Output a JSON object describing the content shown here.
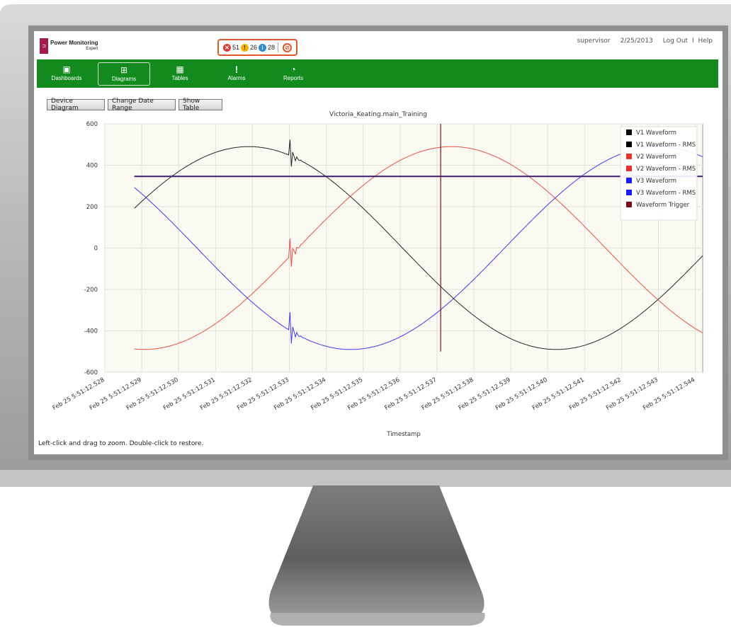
{
  "app": {
    "logo_title": "Power Monitoring",
    "logo_subtitle": "Expert",
    "user": "supervisor",
    "date": "2/25/2013",
    "logout_label": "Log Out",
    "separator": "I",
    "help_label": "Help"
  },
  "alerts": {
    "critical_count": "51",
    "warning_count": "26",
    "info_count": "28"
  },
  "nav": {
    "items": [
      {
        "label": "Dashboards",
        "icon": "dashboard-icon"
      },
      {
        "label": "Diagrams",
        "icon": "diagram-icon"
      },
      {
        "label": "Tables",
        "icon": "table-icon"
      },
      {
        "label": "Alarms",
        "icon": "alarm-icon"
      },
      {
        "label": "Reports",
        "icon": "report-icon"
      }
    ],
    "active": "Diagrams"
  },
  "toolbar": {
    "device_diagram": "Device Diagram",
    "change_date_range": "Change Date Range",
    "show_table": "Show Table"
  },
  "footnote": "Left-click and drag to zoom. Double-click to restore.",
  "colors": {
    "nav_bg": "#138a1e",
    "accent": "#e0582a",
    "v1": "#000000",
    "v2": "#e8332a",
    "v3": "#1a1aff",
    "trigger": "#7a0f1e",
    "rms_line": "#3b1d6e"
  },
  "chart_data": {
    "type": "line",
    "title": "Victoria_Keating.main_Training",
    "xlabel": "Timestamp",
    "ylabel": "",
    "ylim": [
      -600,
      600
    ],
    "yticks": [
      600,
      400,
      200,
      0,
      -200,
      -400,
      -600
    ],
    "xlim": [
      12.528,
      12.5442
    ],
    "xticks": [
      "Feb 25 5:51:12.528",
      "Feb 25 5:51:12.529",
      "Feb 25 5:51:12.530",
      "Feb 25 5:51:12.531",
      "Feb 25 5:51:12.532",
      "Feb 25 5:51:12.533",
      "Feb 25 5:51:12.534",
      "Feb 25 5:51:12.535",
      "Feb 25 5:51:12.536",
      "Feb 25 5:51:12.537",
      "Feb 25 5:51:12.538",
      "Feb 25 5:51:12.539",
      "Feb 25 5:51:12.540",
      "Feb 25 5:51:12.541",
      "Feb 25 5:51:12.542",
      "Feb 25 5:51:12.543",
      "Feb 25 5:51:12.544"
    ],
    "grid": true,
    "legend_position": "top-right",
    "series": [
      {
        "name": "V1 Waveform",
        "x_start": 12.5288,
        "x_end": 12.5442,
        "amplitude": 490,
        "peak_at": 12.5319,
        "period": 0.01667
      },
      {
        "name": "V1 Waveform - RMS",
        "value": 346
      },
      {
        "name": "V2 Waveform",
        "x_start": 12.5288,
        "x_end": 12.5442,
        "amplitude": 490,
        "peak_at": 12.5374,
        "period": 0.01667
      },
      {
        "name": "V2 Waveform - RMS",
        "value": 346
      },
      {
        "name": "V3 Waveform",
        "x_start": 12.5288,
        "x_end": 12.5442,
        "amplitude": 490,
        "peak_at": 12.543,
        "period": 0.01667
      },
      {
        "name": "V3 Waveform - RMS",
        "value": 346
      },
      {
        "name": "Waveform Trigger",
        "x": 12.5371,
        "y_from": -500,
        "y_to": 600
      }
    ],
    "transient": {
      "x": 12.533,
      "spike_v1": 540,
      "spike_v2": 60,
      "spike_v3": -290
    }
  }
}
